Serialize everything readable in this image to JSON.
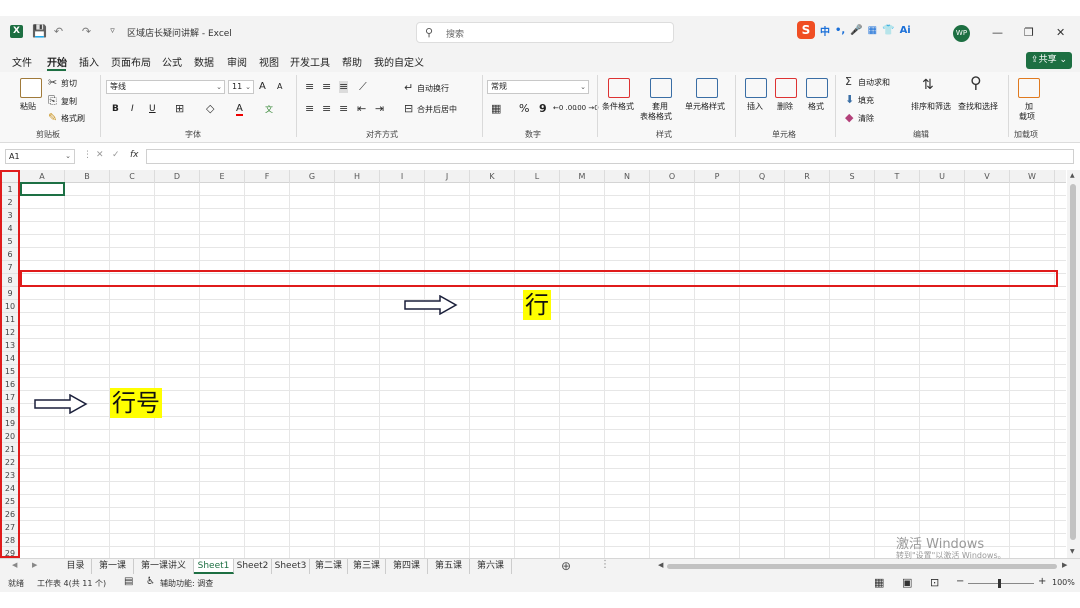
{
  "window": {
    "title": "区域店长疑问讲解 - Excel",
    "search_placeholder": "搜索",
    "avatar": "WP",
    "ime": [
      "中",
      "•,",
      "🎤",
      "▦",
      "👕",
      "Ai"
    ]
  },
  "menu": {
    "items": [
      "文件",
      "开始",
      "插入",
      "页面布局",
      "公式",
      "数据",
      "审阅",
      "视图",
      "开发工具",
      "帮助",
      "我的自定义"
    ],
    "active": "开始",
    "share": "共享"
  },
  "ribbon": {
    "clipboard": {
      "paste": "粘贴",
      "cut": "剪切",
      "copy": "复制",
      "format_painter": "格式刷",
      "label": "剪贴板"
    },
    "font": {
      "name": "等线",
      "size": "11",
      "grow": "A",
      "shrink": "A",
      "bold": "B",
      "italic": "I",
      "underline": "U",
      "fill_char": "A",
      "phonetic": "文",
      "label": "字体"
    },
    "alignment": {
      "wrap": "自动换行",
      "merge": "合并后居中",
      "label": "对齐方式"
    },
    "number": {
      "format": "常规",
      "percent": "%",
      "comma": "9",
      "inc": "←0 .00",
      "dec": ".00 →0",
      "label": "数字"
    },
    "styles": {
      "conditional": "条件格式",
      "table": [
        "套用",
        "表格格式"
      ],
      "cell_styles": "单元格样式",
      "label": "样式"
    },
    "cells": {
      "insert": "插入",
      "delete": "删除",
      "format": "格式",
      "label": "单元格"
    },
    "editing": {
      "autosum": "自动求和",
      "fill": "填充",
      "clear": "清除",
      "sort": "排序和筛选",
      "find": "查找和选择",
      "label": "编辑"
    },
    "addins": {
      "load": [
        "加",
        "载项"
      ],
      "label": "加载项"
    }
  },
  "formula_bar": {
    "name_box": "A1",
    "fx": "fx",
    "value": ""
  },
  "grid": {
    "columns": [
      "A",
      "B",
      "C",
      "D",
      "E",
      "F",
      "G",
      "H",
      "I",
      "J",
      "K",
      "L",
      "M",
      "N",
      "O",
      "P",
      "Q",
      "R",
      "S",
      "T",
      "U",
      "V",
      "W"
    ],
    "rows": [
      "1",
      "2",
      "3",
      "4",
      "5",
      "6",
      "7",
      "8",
      "9",
      "10",
      "11",
      "12",
      "13",
      "14",
      "15",
      "16",
      "17",
      "18",
      "19",
      "20",
      "21",
      "22",
      "23",
      "24",
      "25",
      "26",
      "27",
      "28",
      "29"
    ]
  },
  "annotations": {
    "row_label": "行",
    "row_number_label": "行号"
  },
  "sheets": {
    "tabs": [
      "目录",
      "第一课",
      "第一课讲义",
      "Sheet1",
      "Sheet2",
      "Sheet3",
      "第二课",
      "第三课",
      "第四课",
      "第五课",
      "第六课"
    ],
    "active": "Sheet1"
  },
  "status": {
    "ready": "就绪",
    "workbook": "工作表 4(共 11 个)",
    "accessibility": "辅助功能: 调查",
    "zoom": "100%"
  },
  "watermark": {
    "title": "激活 Windows",
    "subtitle": "转到\"设置\"以激活 Windows。"
  }
}
